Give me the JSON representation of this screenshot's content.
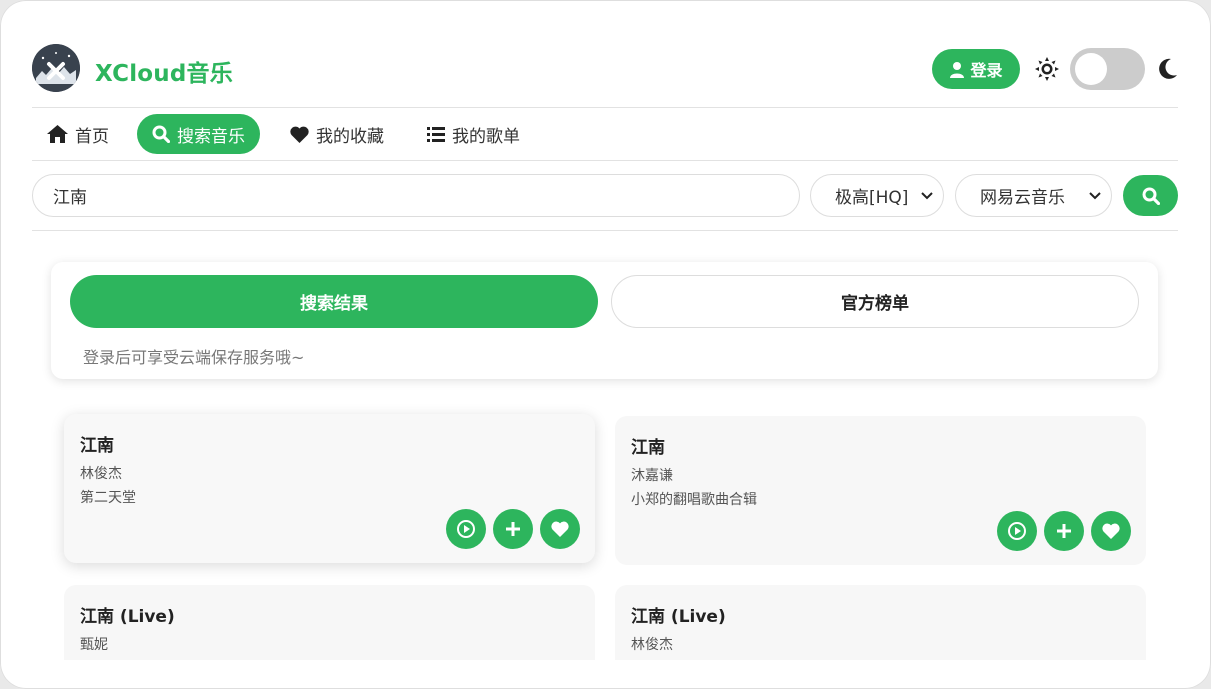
{
  "app": {
    "brand": "XCloud音乐"
  },
  "header": {
    "login_label": "登录"
  },
  "nav": {
    "items": [
      {
        "label": "首页",
        "icon": "home-icon"
      },
      {
        "label": "搜索音乐",
        "icon": "search-icon"
      },
      {
        "label": "我的收藏",
        "icon": "heart-icon"
      },
      {
        "label": "我的歌单",
        "icon": "list-icon"
      }
    ],
    "active_index": 1
  },
  "search": {
    "query": "江南",
    "quality": "极高[HQ]",
    "source": "网易云音乐"
  },
  "tabs": {
    "results_label": "搜索结果",
    "charts_label": "官方榜单",
    "hint": "登录后可享受云端保存服务哦~"
  },
  "songs": [
    {
      "title": "江南",
      "artist": "林俊杰",
      "album": "第二天堂"
    },
    {
      "title": "江南",
      "artist": "沐嘉谦",
      "album": "小郑的翻唱歌曲合辑"
    },
    {
      "title": "江南 (Live)",
      "artist": "甄妮",
      "album": ""
    },
    {
      "title": "江南 (Live)",
      "artist": "林俊杰",
      "album": ""
    }
  ],
  "colors": {
    "accent": "#2db55d",
    "toggle_off": "#cccccc"
  }
}
